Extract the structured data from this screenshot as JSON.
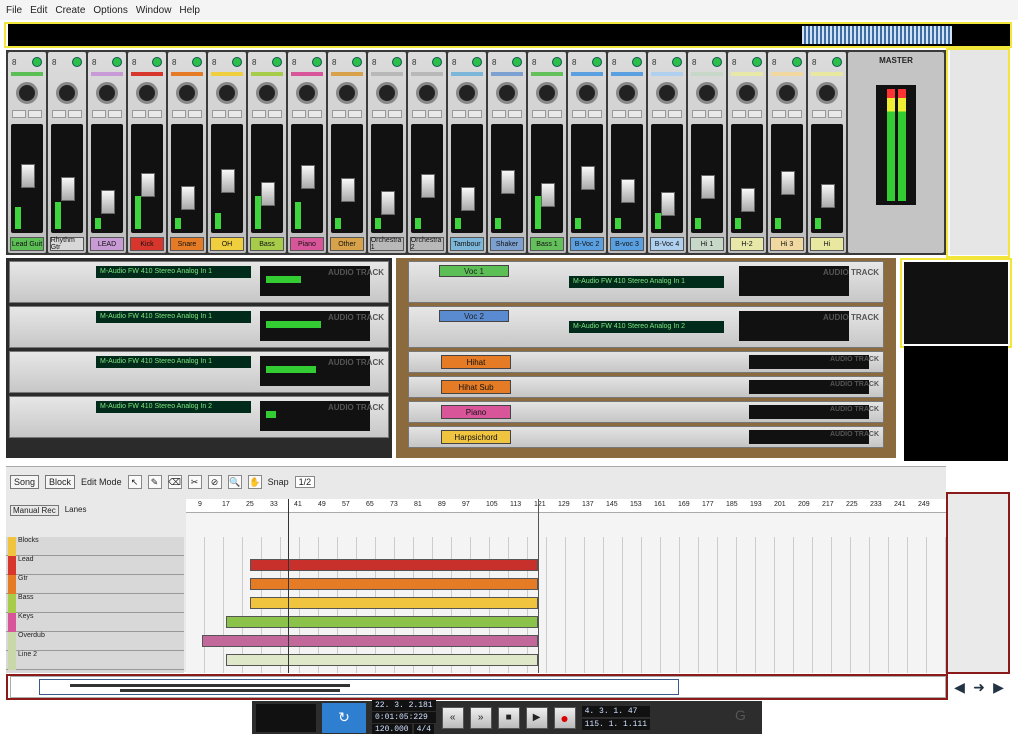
{
  "menu": [
    "File",
    "Edit",
    "Create",
    "Options",
    "Window",
    "Help"
  ],
  "mixer": {
    "channels": [
      {
        "num": "8",
        "label": "Lead Guit",
        "color": "#5bbf56"
      },
      {
        "num": "8",
        "label": "Rhythm Gtr",
        "color": "#d8d8d8"
      },
      {
        "num": "8",
        "label": "LEAD",
        "color": "#c89ad6"
      },
      {
        "num": "8",
        "label": "Kick",
        "color": "#d8362c"
      },
      {
        "num": "8",
        "label": "Snare",
        "color": "#e57b24"
      },
      {
        "num": "8",
        "label": "OH",
        "color": "#f0cf3f"
      },
      {
        "num": "8",
        "label": "Bass",
        "color": "#a6cc4a"
      },
      {
        "num": "8",
        "label": "Piano",
        "color": "#d9559a"
      },
      {
        "num": "8",
        "label": "Other",
        "color": "#d8a24a"
      },
      {
        "num": "8",
        "label": "Orchestra 1",
        "color": "#b8b8b8"
      },
      {
        "num": "8",
        "label": "Orchestra 2",
        "color": "#b8b8b8"
      },
      {
        "num": "8",
        "label": "Tambour",
        "color": "#7cb6d8"
      },
      {
        "num": "8",
        "label": "Shaker",
        "color": "#7ca0d0"
      },
      {
        "num": "8",
        "label": "Bass 1",
        "color": "#64c05a"
      },
      {
        "num": "8",
        "label": "B-Voc 2",
        "color": "#5aa0e0"
      },
      {
        "num": "8",
        "label": "B-voc 3",
        "color": "#5aa0e0"
      },
      {
        "num": "8",
        "label": "B-Voc 4",
        "color": "#b0d0f0"
      },
      {
        "num": "8",
        "label": "Hi 1",
        "color": "#c8d8c8"
      },
      {
        "num": "8",
        "label": "H-2",
        "color": "#e8e8a8"
      },
      {
        "num": "8",
        "label": "Hi 3",
        "color": "#f0d8a0"
      },
      {
        "num": "8",
        "label": "Hi",
        "color": "#e8e8a0"
      }
    ],
    "meter_levels": [
      0.2,
      0.25,
      0.1,
      0.3,
      0.1,
      0.15,
      0.3,
      0.25,
      0.1,
      0.1,
      0.1,
      0.1,
      0.1,
      0.3,
      0.1,
      0.1,
      0.15,
      0.1,
      0.1,
      0.1,
      0.1
    ],
    "master_label": "MASTER"
  },
  "rack_left": [
    {
      "lcd": "M-Audio FW 410 Stereo Analog In 1",
      "title": "AUDIO TRACK",
      "level": 0.35
    },
    {
      "lcd": "M-Audio FW 410 Stereo Analog In 1",
      "title": "AUDIO TRACK",
      "level": 0.55
    },
    {
      "lcd": "M-Audio FW 410 Stereo Analog In 1",
      "title": "AUDIO TRACK",
      "level": 0.5
    },
    {
      "lcd": "M-Audio FW 410 Stereo Analog In 2",
      "title": "AUDIO TRACK",
      "level": 0.1
    }
  ],
  "rack_right_big": [
    {
      "name": "Voc 1",
      "color": "#5bbf56",
      "lcd": "M-Audio FW 410 Stereo Analog In 1",
      "title": "AUDIO TRACK"
    },
    {
      "name": "Voc 2",
      "color": "#5a8ad0",
      "lcd": "M-Audio FW 410 Stereo Analog In 2",
      "title": "AUDIO TRACK"
    }
  ],
  "rack_right_small": [
    {
      "name": "Hihat",
      "color": "#e57b24",
      "title": "AUDIO TRACK"
    },
    {
      "name": "Hihat Sub",
      "color": "#e57b24",
      "title": "AUDIO TRACK"
    },
    {
      "name": "Piano",
      "color": "#d9559a",
      "title": "AUDIO TRACK"
    },
    {
      "name": "Harpsichord",
      "color": "#f0c43f",
      "title": "AUDIO TRACK"
    }
  ],
  "sequencer": {
    "modes": [
      "Song",
      "Block"
    ],
    "edit_mode": "Edit Mode",
    "snap_label": "Snap",
    "snap_value": "1/2",
    "manual_rec": "Manual Rec",
    "lanes": "Lanes",
    "ruler": [
      "9",
      "17",
      "25",
      "33",
      "41",
      "49",
      "57",
      "65",
      "73",
      "81",
      "89",
      "97",
      "105",
      "113",
      "121",
      "129",
      "137",
      "145",
      "153",
      "161",
      "169",
      "177",
      "185",
      "193",
      "201",
      "209",
      "217",
      "225",
      "233",
      "241",
      "249"
    ],
    "tracks": [
      {
        "name": "Blocks",
        "color": "#f0c43f"
      },
      {
        "name": "Lead",
        "color": "#d8362c"
      },
      {
        "name": "Gtr",
        "color": "#e57b24"
      },
      {
        "name": "Bass",
        "color": "#a6cc4a"
      },
      {
        "name": "Keys",
        "color": "#d9559a"
      },
      {
        "name": "Overdub",
        "color": "#c8d8a8"
      },
      {
        "name": "Line 2",
        "color": "#c8d8a8"
      }
    ],
    "clips": [
      {
        "track": 1,
        "start": 64,
        "end": 352,
        "color": "#c8302c"
      },
      {
        "track": 2,
        "start": 64,
        "end": 352,
        "color": "#e57b24"
      },
      {
        "track": 3,
        "start": 64,
        "end": 352,
        "color": "#f0c43f"
      },
      {
        "track": 4,
        "start": 40,
        "end": 352,
        "color": "#8bc34a"
      },
      {
        "track": 5,
        "start": 16,
        "end": 352,
        "color": "#c3689a"
      },
      {
        "track": 6,
        "start": 40,
        "end": 352,
        "color": "#dfe8c8"
      }
    ]
  },
  "transport": {
    "position_1": "22. 3. 2.181",
    "time": "0:01:05:229",
    "tempo": "120.000",
    "signature": "4/4",
    "left_loc": "4. 3. 1. 47",
    "right_loc": "115. 1. 1.111"
  }
}
